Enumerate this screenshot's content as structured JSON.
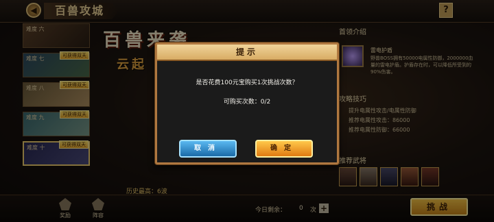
{
  "header": {
    "title": "百兽攻城",
    "help_label": "?"
  },
  "levels": [
    {
      "label": "难度 六",
      "badge": ""
    },
    {
      "label": "难度 七",
      "badge": "可获得双天"
    },
    {
      "label": "难度 八",
      "badge": "可获得双天"
    },
    {
      "label": "难度 九",
      "badge": "可获得双天"
    },
    {
      "label": "难度 十",
      "badge": "可获得双天"
    }
  ],
  "banner": {
    "title": "百兽来袭",
    "subtitle": "云起"
  },
  "best_record": {
    "label": "历史最高：",
    "value": "6波"
  },
  "right_panel": {
    "boss_section": "首领介绍",
    "boss_name": "雷电护盾",
    "boss_desc": "野兽BOSS拥有50000电属性防御，2000000血量的雷电护盾。护盾存在时，可以降低所受到的90%伤害。",
    "tips_section": "攻略技巧",
    "tips": [
      "提升电属性攻击/电属性防御",
      "推荐电属性攻击：86000",
      "推荐电属性防御：66000"
    ],
    "heroes_section": "推荐武将"
  },
  "bottom": {
    "reward_label": "奖励",
    "lineup_label": "阵容",
    "remain_label": "今日剩余：",
    "remain_count": "0",
    "remain_unit": "次",
    "challenge_label": "挑战"
  },
  "dialog": {
    "title": "提示",
    "message": "是否花费100元宝购买1次挑战次数？",
    "count_text": "可购买次数：0/2",
    "cancel_label": "取消",
    "confirm_label": "确定"
  },
  "colors": {
    "cancel": "#1a6aa8",
    "confirm": "#e07a12",
    "frame": "#b07840"
  }
}
